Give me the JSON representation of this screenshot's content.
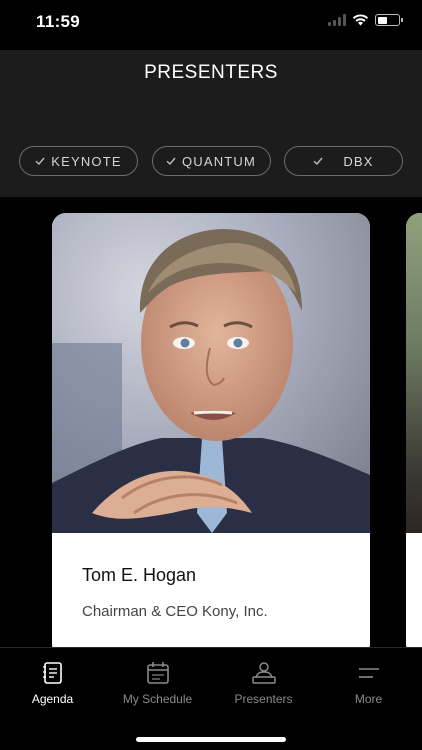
{
  "status": {
    "time": "11:59"
  },
  "header": {
    "title": "PRESENTERS"
  },
  "filters": [
    {
      "label": "KEYNOTE",
      "icon": "check-icon"
    },
    {
      "label": "QUANTUM",
      "icon": "check-icon"
    },
    {
      "label": "DBX",
      "icon": "check-icon"
    }
  ],
  "presenter": {
    "name": "Tom E. Hogan",
    "role": "Chairman & CEO Kony, Inc."
  },
  "tabs": [
    {
      "label": "Agenda",
      "icon": "agenda-icon",
      "active": true
    },
    {
      "label": "My Schedule",
      "icon": "calendar-icon",
      "active": false
    },
    {
      "label": "Presenters",
      "icon": "presenters-icon",
      "active": false
    },
    {
      "label": "More",
      "icon": "menu-icon",
      "active": false
    }
  ]
}
